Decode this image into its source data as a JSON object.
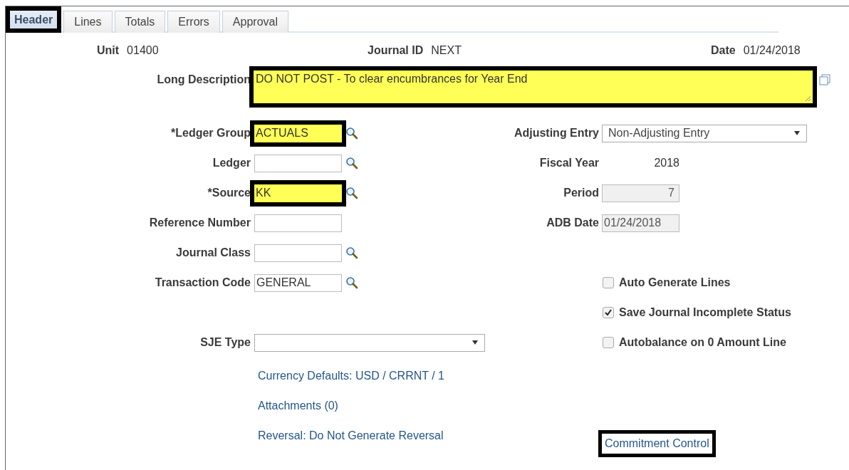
{
  "tabs": [
    {
      "label": "Header",
      "selected": true,
      "highlighted": true
    },
    {
      "label": "Lines",
      "selected": false,
      "highlighted": false
    },
    {
      "label": "Totals",
      "selected": false,
      "highlighted": false
    },
    {
      "label": "Errors",
      "selected": false,
      "highlighted": false
    },
    {
      "label": "Approval",
      "selected": false,
      "highlighted": false
    }
  ],
  "header": [
    {
      "label": "Unit",
      "value": "01400"
    },
    {
      "label": "Journal ID",
      "value": "NEXT"
    },
    {
      "label": "Date",
      "value": "01/24/2018"
    }
  ],
  "long_description": {
    "label": "Long Description",
    "value": "DO NOT POST - To clear encumbrances for Year End",
    "highlighted": true
  },
  "left_fields": [
    {
      "label": "*Ledger Group",
      "value": "ACTUALS",
      "kind": "lookup",
      "highlighted": true
    },
    {
      "label": "Ledger",
      "kind": "lookup",
      "highlighted": false
    },
    {
      "label": "*Source",
      "value": "KK",
      "kind": "lookup",
      "highlighted": true
    },
    {
      "label": "Reference Number",
      "kind": "text",
      "highlighted": false
    },
    {
      "label": "Journal Class",
      "kind": "lookup",
      "highlighted": false
    },
    {
      "label": "Transaction Code",
      "value": "GENERAL",
      "kind": "lookup",
      "highlighted": false
    },
    {
      "label": "SJE Type",
      "kind": "select"
    }
  ],
  "links": [
    {
      "label": "Currency Defaults: USD / CRRNT / 1"
    },
    {
      "label": "Attachments (0)"
    },
    {
      "label": "Reversal: Do Not Generate Reversal"
    }
  ],
  "right_fields": [
    {
      "label": "Adjusting Entry",
      "value": "Non-Adjusting Entry",
      "kind": "select"
    },
    {
      "label": "Fiscal Year",
      "value": "2018",
      "kind": "display"
    },
    {
      "label": "Period",
      "value": "7",
      "kind": "readonly_number"
    },
    {
      "label": "ADB Date",
      "value": "01/24/2018",
      "kind": "readonly"
    }
  ],
  "checkboxes": [
    {
      "label": "Auto Generate Lines",
      "checked": false
    },
    {
      "label": "Save Journal Incomplete Status",
      "checked": true
    },
    {
      "label": "Autobalance on 0 Amount Line",
      "checked": false
    }
  ],
  "commitment_link": {
    "label": "Commitment Control",
    "highlighted": true
  }
}
